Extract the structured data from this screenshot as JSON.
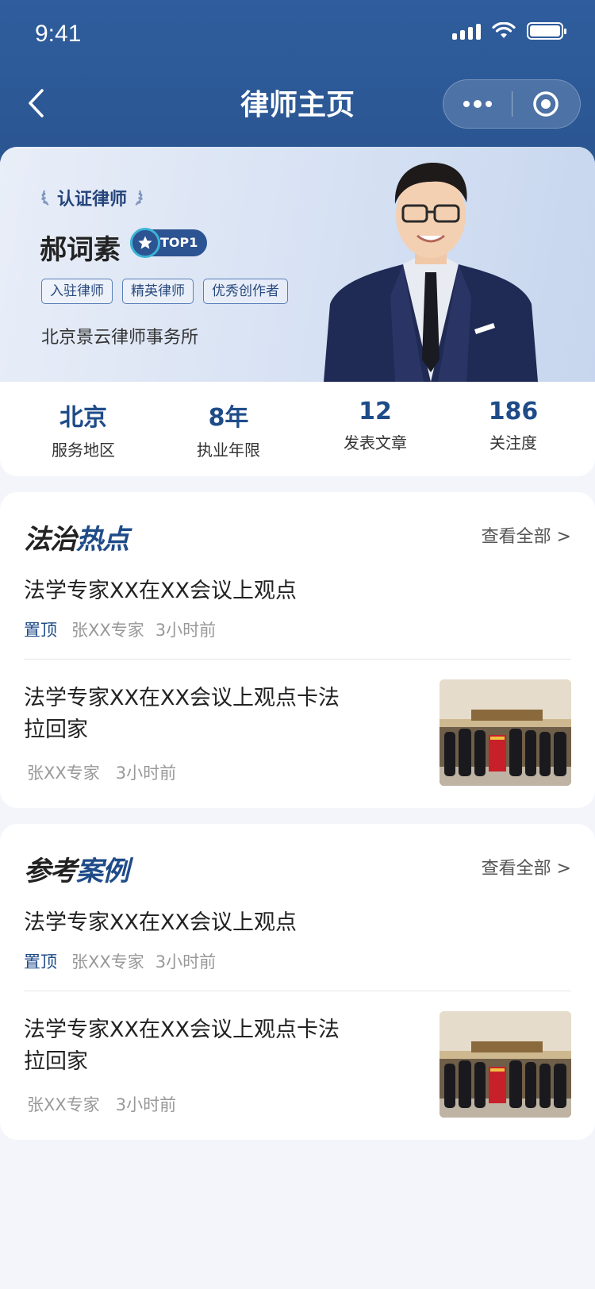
{
  "status_bar": {
    "time": "9:41"
  },
  "nav": {
    "title": "律师主页"
  },
  "profile": {
    "cert_label": "认证律师",
    "name": "郝词素",
    "badge": "TOP1",
    "tags": [
      "入驻律师",
      "精英律师",
      "优秀创作者"
    ],
    "firm": "北京景云律师事务所"
  },
  "stats": [
    {
      "value": "北京",
      "label": "服务地区"
    },
    {
      "value": "8年",
      "label": "执业年限"
    },
    {
      "value": "12",
      "label": "发表文章"
    },
    {
      "value": "186",
      "label": "关注度"
    }
  ],
  "sections": [
    {
      "title_a": "法治",
      "title_b": "热点",
      "view_all": "查看全部 >",
      "items": [
        {
          "title": "法学专家XX在XX会议上观点",
          "pin": "置顶",
          "author": "张XX专家",
          "time": "3小时前"
        },
        {
          "title_line1": "法学专家XX在XX会议上观点卡法",
          "title_line2": "拉回家",
          "author": "张XX专家",
          "time": "3小时前"
        }
      ]
    },
    {
      "title_a": "参考",
      "title_b": "案例",
      "view_all": "查看全部 >",
      "items": [
        {
          "title": "法学专家XX在XX会议上观点",
          "pin": "置顶",
          "author": "张XX专家",
          "time": "3小时前"
        },
        {
          "title_line1": "法学专家XX在XX会议上观点卡法",
          "title_line2": "拉回家",
          "author": "张XX专家",
          "time": "3小时前"
        }
      ]
    }
  ],
  "colors": {
    "primary": "#1f4c89",
    "header": "#2f5d9d",
    "background": "#f3f5fa"
  }
}
